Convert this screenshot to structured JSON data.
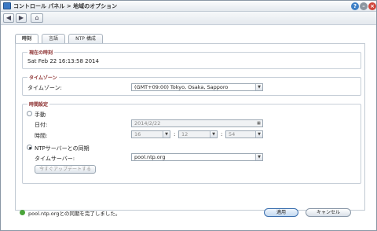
{
  "window": {
    "title": "コントロール パネル > 地域のオプション"
  },
  "tabs": [
    {
      "label": "時刻"
    },
    {
      "label": "言語"
    },
    {
      "label": "NTP 構成"
    }
  ],
  "current_time": {
    "legend": "現在の時刻",
    "value": "Sat Feb 22 16:13:58 2014"
  },
  "timezone": {
    "legend": "タイムゾーン",
    "label": "タイムゾーン:",
    "value": "(GMT+09:00) Tokyo, Osaka, Sapporo"
  },
  "time_settings": {
    "legend": "時間設定",
    "manual_label": "手動",
    "date_label": "日付:",
    "date_value": "2014/2/22",
    "time_label": "時間:",
    "hour": "16",
    "minute": "12",
    "second": "54",
    "sep": ":",
    "ntp_label": "NTPサーバーとの同期",
    "server_label": "タイムサーバー:",
    "server_value": "pool.ntp.org",
    "update_button": "今すぐアップデートする"
  },
  "footer": {
    "status": "pool.ntp.orgとの同期を完了しました。",
    "apply_label": "適用",
    "cancel_label": "キャンセル"
  },
  "colors": {
    "legend": "#8a2c2c",
    "status_ok": "#4aa43a",
    "accent": "#3b6fae"
  }
}
